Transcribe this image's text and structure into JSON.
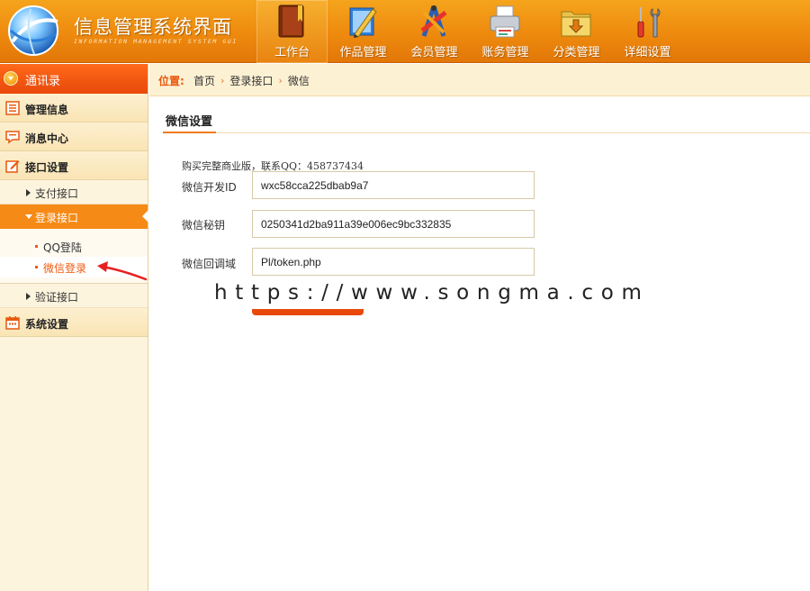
{
  "header": {
    "title": "信息管理系统界面",
    "subtitle": "INFORMATION MANAGEMENT SYSTEM GUI",
    "nav": [
      {
        "label": "工作台",
        "icon": "book-icon",
        "active": true
      },
      {
        "label": "作品管理",
        "icon": "ruler-pencil-icon",
        "active": false
      },
      {
        "label": "会员管理",
        "icon": "tools-icon",
        "active": false
      },
      {
        "label": "账务管理",
        "icon": "printer-icon",
        "active": false
      },
      {
        "label": "分类管理",
        "icon": "folder-download-icon",
        "active": false
      },
      {
        "label": "详细设置",
        "icon": "screwdriver-wrench-icon",
        "active": false
      }
    ]
  },
  "sidebar": {
    "header": "通讯录",
    "groups": {
      "manage": "管理信息",
      "messages": "消息中心",
      "interfaces": "接口设置",
      "system": "系统设置"
    },
    "sub": {
      "payment": "支付接口",
      "login": "登录接口",
      "verify": "验证接口"
    },
    "leaves": {
      "qq": "QQ登陆",
      "wechat": "微信登录"
    }
  },
  "breadcrumb": {
    "label": "位置:",
    "items": [
      "首页",
      "登录接口",
      "微信"
    ],
    "separator": "›"
  },
  "main": {
    "section_title": "微信设置",
    "notice": "购买完整商业版，联系QQ：458737434",
    "fields": [
      {
        "label": "微信开发ID",
        "value": "wxc58cca225dbab9a7"
      },
      {
        "label": "微信秘钥",
        "value": "0250341d2ba911a39e006ec9bc332835"
      },
      {
        "label": "微信回调域",
        "value": "Pl/token.php"
      }
    ]
  },
  "watermark": "https://www.songma.com",
  "colors": {
    "header_orange": "#ee8a0e",
    "sidebar_head": "#e8490b",
    "active_sub": "#f68a16",
    "accent_text": "#f05a10",
    "sidebar_bg": "#fdf4de"
  }
}
